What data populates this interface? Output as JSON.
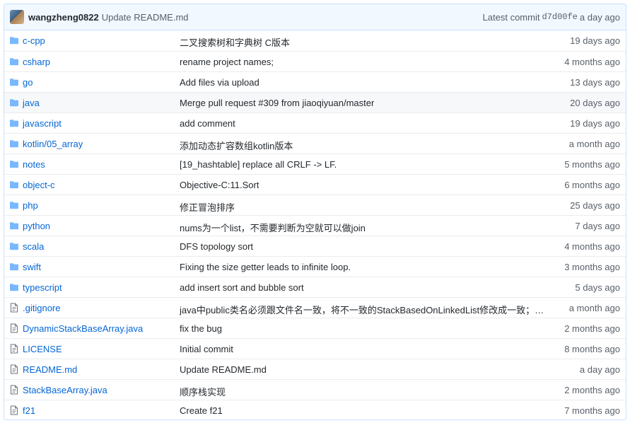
{
  "commit": {
    "author": "wangzheng0822",
    "message": "Update README.md",
    "latest_label": "Latest commit",
    "sha": "d7d00fe",
    "age": "a day ago"
  },
  "colors": {
    "link": "#0366d6",
    "folder": "#79b8ff",
    "header_bg": "#f1f8ff",
    "border": "#c8e1ff"
  },
  "rows": [
    {
      "type": "dir",
      "icon": "folder-icon",
      "name": "c-cpp",
      "message": "二叉搜索树和字典树 C版本",
      "age": "19 days ago"
    },
    {
      "type": "dir",
      "icon": "folder-icon",
      "name": "csharp",
      "message": "rename project names;",
      "age": "4 months ago"
    },
    {
      "type": "dir",
      "icon": "folder-icon",
      "name": "go",
      "message": "Add files via upload",
      "age": "13 days ago"
    },
    {
      "type": "dir",
      "icon": "folder-icon",
      "name": "java",
      "message": "Merge pull request #309 from jiaoqiyuan/master",
      "age": "20 days ago"
    },
    {
      "type": "dir",
      "icon": "folder-icon",
      "name": "javascript",
      "message": "add comment",
      "age": "19 days ago"
    },
    {
      "type": "dir",
      "icon": "folder-icon",
      "name": "kotlin/05_array",
      "message": "添加动态扩容数组kotlin版本",
      "age": "a month ago"
    },
    {
      "type": "dir",
      "icon": "folder-icon",
      "name": "notes",
      "message": "[19_hashtable] replace all CRLF -> LF.",
      "age": "5 months ago"
    },
    {
      "type": "dir",
      "icon": "folder-icon",
      "name": "object-c",
      "message": "Objective-C:11.Sort",
      "age": "6 months ago"
    },
    {
      "type": "dir",
      "icon": "folder-icon",
      "name": "php",
      "message": "修正冒泡排序",
      "age": "25 days ago"
    },
    {
      "type": "dir",
      "icon": "folder-icon",
      "name": "python",
      "message": "nums为一个list，不需要判断为空就可以做join",
      "age": "7 days ago"
    },
    {
      "type": "dir",
      "icon": "folder-icon",
      "name": "scala",
      "message": "DFS topology sort",
      "age": "4 months ago"
    },
    {
      "type": "dir",
      "icon": "folder-icon",
      "name": "swift",
      "message": "Fixing the size getter leads to infinite loop.",
      "age": "3 months ago"
    },
    {
      "type": "dir",
      "icon": "folder-icon",
      "name": "typescript",
      "message": "add insert sort and bubble sort",
      "age": "5 days ago"
    },
    {
      "type": "file",
      "icon": "file-icon",
      "name": ".gitignore",
      "message": "java中public类名必须跟文件名一致，将不一致的StackBasedOnLinkedList修改成一致；在.gi…",
      "age": "a month ago"
    },
    {
      "type": "file",
      "icon": "file-icon",
      "name": "DynamicStackBaseArray.java",
      "message": "fix the bug",
      "age": "2 months ago"
    },
    {
      "type": "file",
      "icon": "file-icon",
      "name": "LICENSE",
      "message": "Initial commit",
      "age": "8 months ago"
    },
    {
      "type": "file",
      "icon": "file-icon",
      "name": "README.md",
      "message": "Update README.md",
      "age": "a day ago"
    },
    {
      "type": "file",
      "icon": "file-icon",
      "name": "StackBaseArray.java",
      "message": "顺序栈实现",
      "age": "2 months ago"
    },
    {
      "type": "file",
      "icon": "file-icon",
      "name": "f21",
      "message": "Create f21",
      "age": "7 months ago"
    }
  ]
}
